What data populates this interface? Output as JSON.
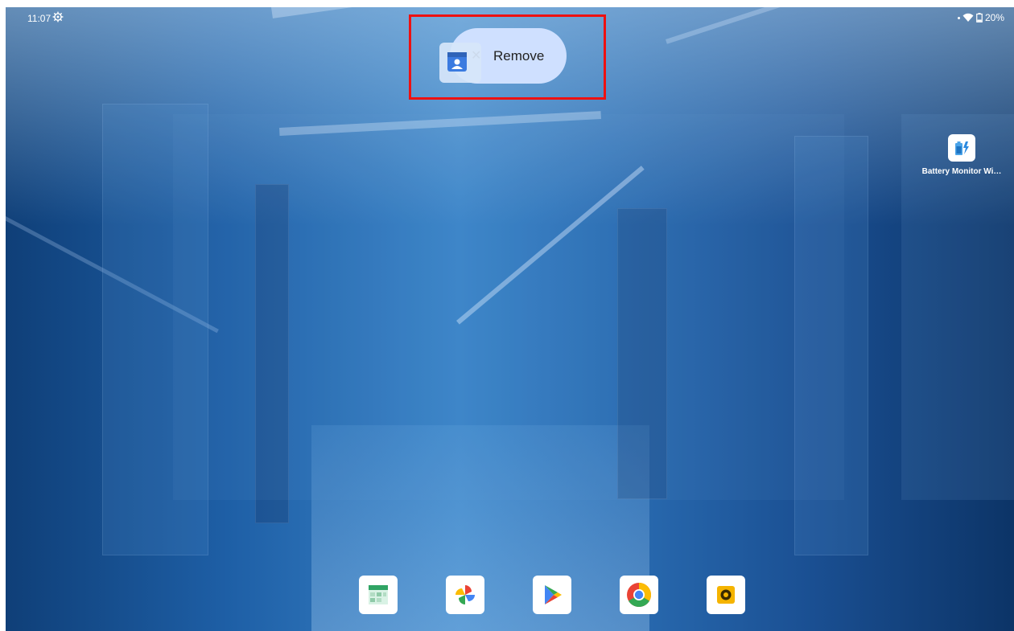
{
  "status_bar": {
    "time": "11:07",
    "settings_icon": "gear-icon",
    "battery_percent": "20%",
    "wifi_icon": "wifi-icon",
    "battery_icon": "battery-icon"
  },
  "drop_target": {
    "label": "Remove",
    "close_glyph": "✕",
    "dragged_app_icon": "contacts-icon",
    "highlight_color": "#e11111"
  },
  "home": {
    "apps": [
      {
        "label": "Battery Monitor Wi…",
        "icon": "battery-monitor-icon"
      }
    ]
  },
  "dock": {
    "apps": [
      {
        "icon": "sheets-calendar-icon"
      },
      {
        "icon": "photos-pinwheel-icon"
      },
      {
        "icon": "play-store-icon"
      },
      {
        "icon": "chrome-icon"
      },
      {
        "icon": "yellow-camera-icon"
      }
    ]
  }
}
